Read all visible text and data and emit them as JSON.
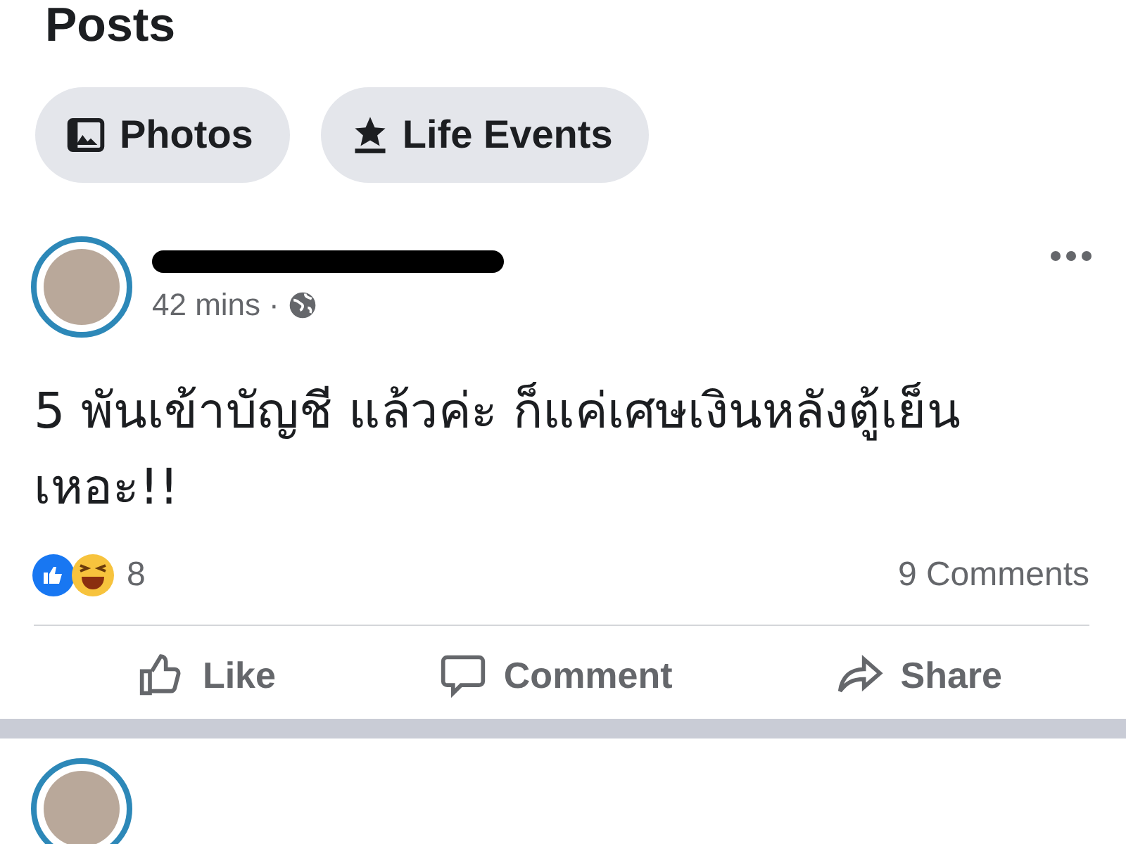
{
  "section_title": "Posts",
  "filters": [
    {
      "label": "Photos",
      "kind": "photos"
    },
    {
      "label": "Life Events",
      "kind": "events"
    }
  ],
  "posts": [
    {
      "author_redacted": true,
      "time": "42 mins",
      "separator": "·",
      "audience_public": true,
      "text": "5 พันเข้าบัญชี แล้วค่ะ ก็แค่เศษเงินหลังตู้เย็น เหอะ!!",
      "reaction_count": "8",
      "comments": "9 Comments",
      "actions": [
        {
          "label": "Like",
          "kind": "like"
        },
        {
          "label": "Comment",
          "kind": "comment"
        },
        {
          "label": "Share",
          "kind": "share"
        }
      ]
    }
  ]
}
